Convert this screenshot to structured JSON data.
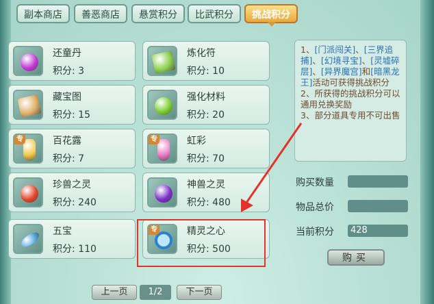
{
  "tabs": [
    {
      "label": "副本商店",
      "active": false
    },
    {
      "label": "善恶商店",
      "active": false
    },
    {
      "label": "悬赏积分",
      "active": false
    },
    {
      "label": "比武积分",
      "active": false
    },
    {
      "label": "挑战积分",
      "active": true
    }
  ],
  "points_prefix": "积分:",
  "items": [
    {
      "name": "还童丹",
      "points": "3",
      "icon": "purple-pill-icon",
      "exclusive": false,
      "color": "#c33ad6"
    },
    {
      "name": "炼化符",
      "points": "10",
      "icon": "green-talisman-icon",
      "exclusive": false,
      "color": "#8fd14f"
    },
    {
      "name": "藏宝图",
      "points": "15",
      "icon": "treasure-map-icon",
      "exclusive": false,
      "color": "#e1b36a"
    },
    {
      "name": "强化材料",
      "points": "20",
      "icon": "green-orb-icon",
      "exclusive": false,
      "color": "#7ccf32"
    },
    {
      "name": "百花露",
      "points": "7",
      "icon": "flower-dew-vase-icon",
      "exclusive": true,
      "color": "#f1c94a"
    },
    {
      "name": "虹彩",
      "points": "70",
      "icon": "rainbow-potion-icon",
      "exclusive": true,
      "color": "#e87ec6"
    },
    {
      "name": "珍兽之灵",
      "points": "240",
      "icon": "red-orb-icon",
      "exclusive": false,
      "color": "#e4462a"
    },
    {
      "name": "神兽之灵",
      "points": "480",
      "icon": "purple-orb-icon",
      "exclusive": false,
      "color": "#7a2fc6"
    },
    {
      "name": "五宝",
      "points": "110",
      "icon": "peacock-feather-icon",
      "exclusive": false,
      "color": "#5fb0e6"
    },
    {
      "name": "精灵之心",
      "points": "500",
      "icon": "blue-amulet-icon",
      "exclusive": true,
      "color": "#2d7fd0"
    }
  ],
  "exclusive_badge": "专",
  "info": {
    "line1_prefix": "1、",
    "kw1": "[门派闯关]",
    "sep1": "、",
    "kw2": "[三界追捕]",
    "sep2": "、",
    "kw3": "[幻境寻宝]",
    "sep3": "、",
    "kw4": "[灵墟碎层]",
    "sep4": "、",
    "kw5": "[异界魔宫]",
    "and": "和",
    "kw6": "[暗黑龙王]",
    "line1_suffix": "活动可获得挑战积分",
    "line2": "2、所获得的挑战积分可以通用兑换奖励",
    "line3": "3、部分道具专用不可出售"
  },
  "fields": {
    "buy_qty_label": "购买数量",
    "buy_qty_value": "",
    "total_label": "物品总价",
    "total_value": "",
    "current_label": "当前积分",
    "current_value": "428"
  },
  "buy_button": "购买",
  "pagination": {
    "prev": "上一页",
    "page": "1/2",
    "next": "下一页"
  },
  "colors": {
    "active_tab": "#e9a83a",
    "highlight": "#e2322a",
    "keyword": "#2a6fb8"
  }
}
